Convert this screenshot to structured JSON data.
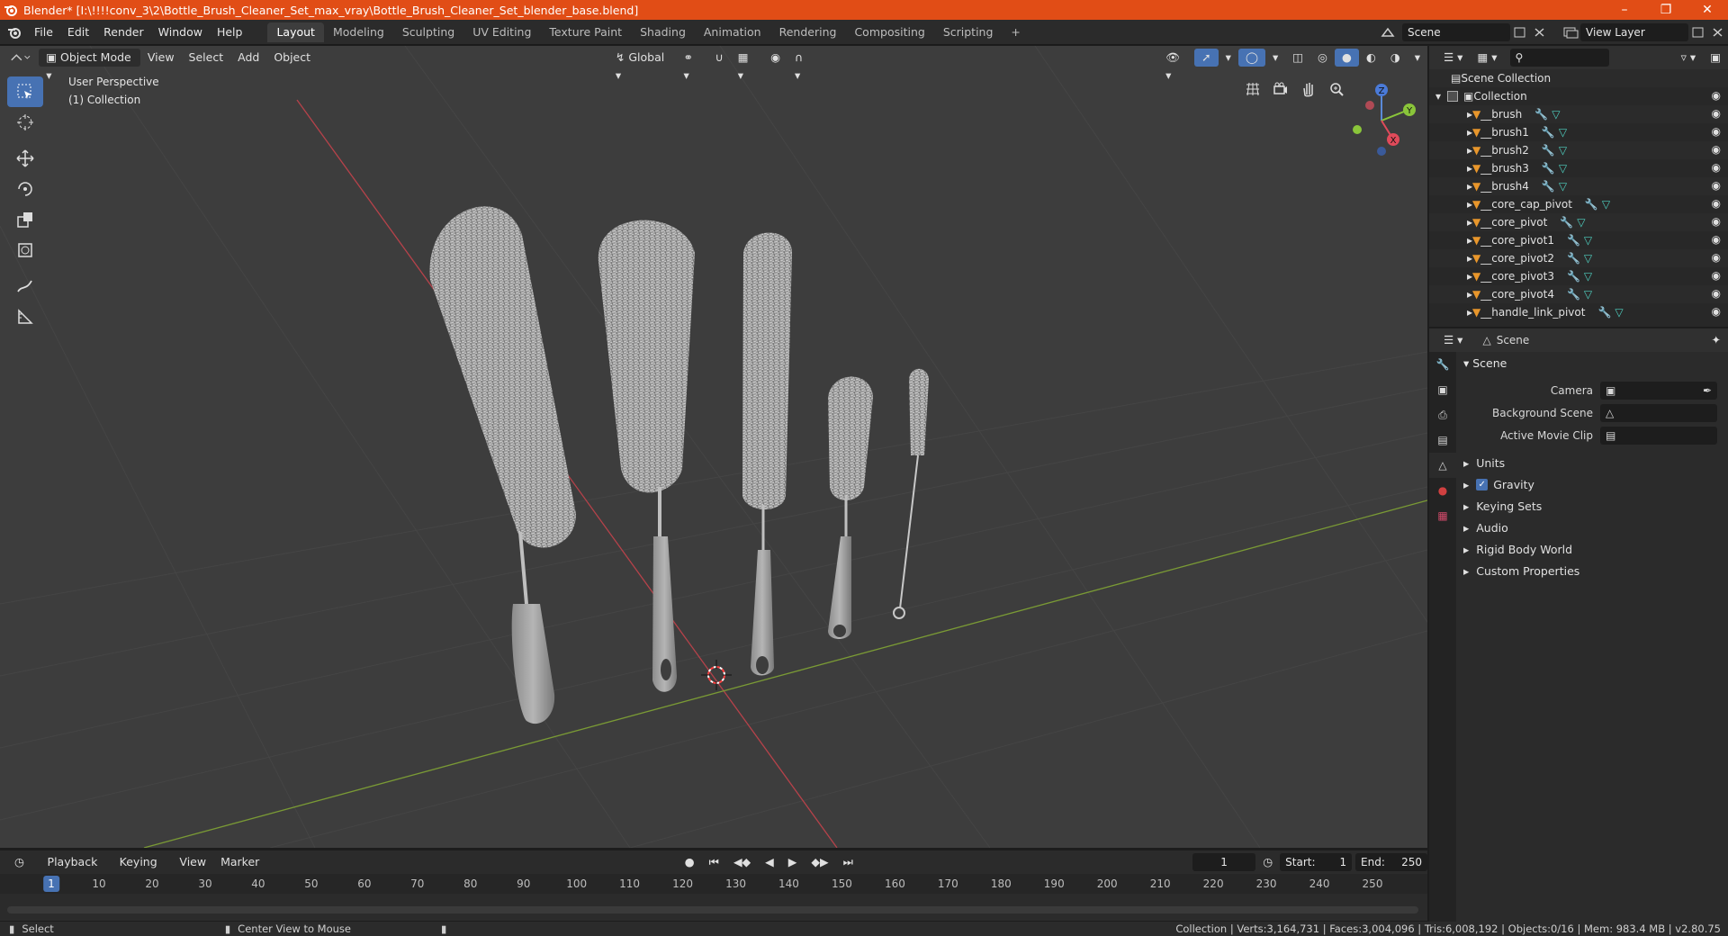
{
  "window": {
    "title": "Blender* [I:\\!!!!conv_3\\2\\Bottle_Brush_Cleaner_Set_max_vray\\Bottle_Brush_Cleaner_Set_blender_base.blend]",
    "accent_color": "#e14d16"
  },
  "menu": [
    "File",
    "Edit",
    "Render",
    "Window",
    "Help"
  ],
  "workspaces": [
    "Layout",
    "Modeling",
    "Sculpting",
    "UV Editing",
    "Texture Paint",
    "Shading",
    "Animation",
    "Rendering",
    "Compositing",
    "Scripting"
  ],
  "active_workspace": "Layout",
  "scene_field": "Scene",
  "view_layer_field": "View Layer",
  "viewport": {
    "mode": "Object Mode",
    "menus": [
      "View",
      "Select",
      "Add",
      "Object"
    ],
    "transform_orientation": "Global",
    "perspective_label": "User Perspective",
    "collection_label": "(1) Collection",
    "gizmo": {
      "z": "Z",
      "y": "Y",
      "x": "X"
    }
  },
  "outliner": {
    "root": "Scene Collection",
    "collection": "Collection",
    "items": [
      "__brush",
      "__brush1",
      "__brush2",
      "__brush3",
      "__brush4",
      "__core_cap_pivot",
      "__core_pivot",
      "__core_pivot1",
      "__core_pivot2",
      "__core_pivot3",
      "__core_pivot4",
      "__handle_link_pivot"
    ]
  },
  "properties": {
    "context": "Scene",
    "panel": "Scene",
    "camera_label": "Camera",
    "background_scene_label": "Background Scene",
    "active_clip_label": "Active Movie Clip",
    "subpanels": [
      "Units",
      "Gravity",
      "Keying Sets",
      "Audio",
      "Rigid Body World",
      "Custom Properties"
    ]
  },
  "timeline": {
    "menus": [
      "Playback",
      "Keying",
      "View",
      "Marker"
    ],
    "current_frame": "1",
    "start_label": "Start:",
    "start": "1",
    "end_label": "End:",
    "end": "250",
    "ticks": [
      "1",
      "10",
      "20",
      "30",
      "40",
      "50",
      "60",
      "70",
      "80",
      "90",
      "100",
      "110",
      "120",
      "130",
      "140",
      "150",
      "160",
      "170",
      "180",
      "190",
      "200",
      "210",
      "220",
      "230",
      "240",
      "250"
    ]
  },
  "status": {
    "left": "Select",
    "middle": "Center View to Mouse",
    "right": "Collection | Verts:3,164,731 | Faces:3,004,096 | Tris:6,008,192 | Objects:0/16 | Mem: 983.4 MB | v2.80.75"
  }
}
